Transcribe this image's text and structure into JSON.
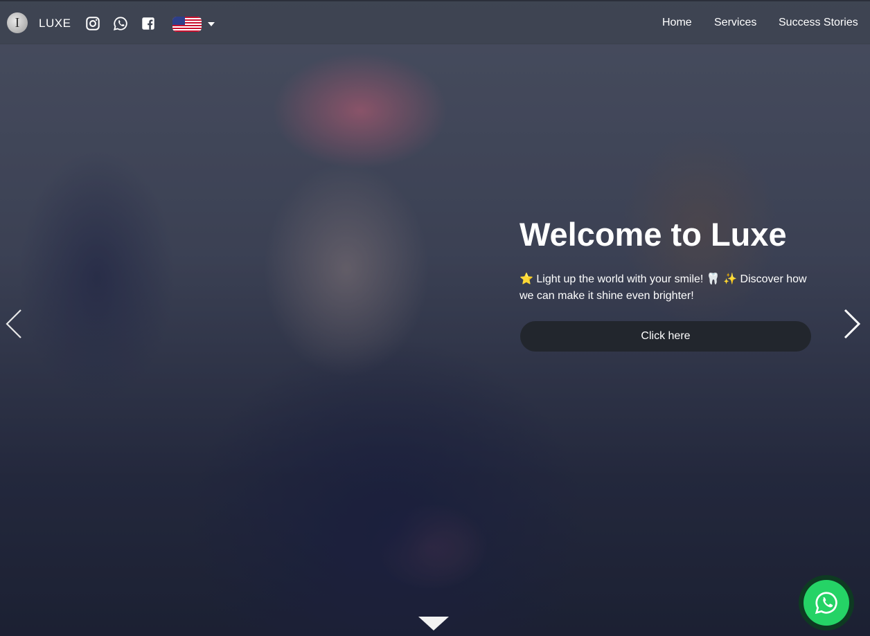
{
  "navbar": {
    "brand": {
      "logo_letter": "I",
      "name": "LUXE"
    },
    "social_icons": [
      "instagram-icon",
      "whatsapp-icon",
      "facebook-icon"
    ],
    "language": {
      "selected_flag": "us-flag-icon"
    },
    "links": [
      {
        "label": "Home"
      },
      {
        "label": "Services"
      },
      {
        "label": "Success Stories"
      }
    ]
  },
  "hero": {
    "title": "Welcome to Luxe",
    "subtitle": "⭐ Light up the world with your smile! 🦷 ✨ Discover how we can make it shine even brighter!",
    "cta_label": "Click here",
    "prev_icon": "chevron-left-icon",
    "next_icon": "chevron-right-icon",
    "scroll_icon": "caret-down-icon"
  },
  "floating": {
    "whatsapp_icon": "whatsapp-icon"
  },
  "colors": {
    "cta_background": "#22262d",
    "whatsapp_green": "#25d366",
    "text": "#ffffff"
  }
}
